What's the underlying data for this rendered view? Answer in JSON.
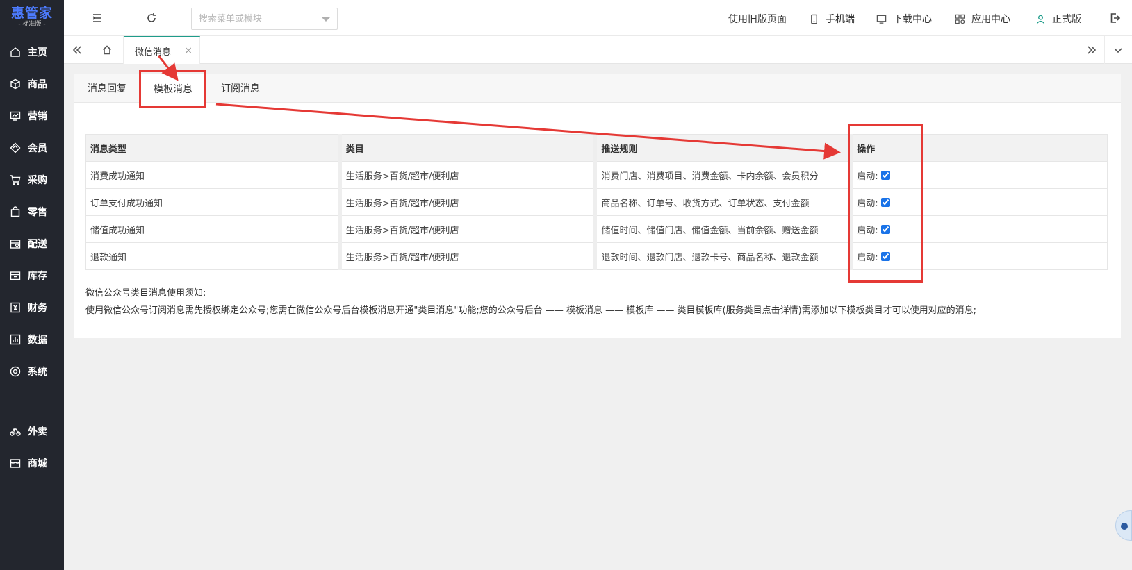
{
  "brand": {
    "name": "惠管家",
    "edition": "- 标准版 -"
  },
  "sidebar": {
    "items": [
      {
        "label": "主页",
        "icon": "home-icon"
      },
      {
        "label": "商品",
        "icon": "box-icon"
      },
      {
        "label": "营销",
        "icon": "chart-screen-icon"
      },
      {
        "label": "会员",
        "icon": "diamond-icon"
      },
      {
        "label": "采购",
        "icon": "cart-icon"
      },
      {
        "label": "零售",
        "icon": "bag-icon"
      },
      {
        "label": "配送",
        "icon": "delivery-icon"
      },
      {
        "label": "库存",
        "icon": "inventory-icon"
      },
      {
        "label": "财务",
        "icon": "yen-icon"
      },
      {
        "label": "数据",
        "icon": "bar-chart-icon"
      },
      {
        "label": "系统",
        "icon": "settings-icon"
      },
      {
        "label": "外卖",
        "icon": "bike-icon"
      },
      {
        "label": "商城",
        "icon": "store-icon"
      }
    ]
  },
  "topbar": {
    "search_placeholder": "搜索菜单或模块",
    "old_version": "使用旧版页面",
    "mobile": "手机端",
    "download": "下载中心",
    "apps": "应用中心",
    "account": "正式版"
  },
  "tabs": {
    "active": "微信消息",
    "close": "×"
  },
  "subtabs": [
    "消息回复",
    "模板消息",
    "订阅消息"
  ],
  "table": {
    "headers": [
      "消息类型",
      "类目",
      "推送规则",
      "操作"
    ],
    "rows": [
      {
        "type": "消费成功通知",
        "category": "生活服务>百货/超市/便利店",
        "rule": "消费门店、消费项目、消费金额、卡内余额、会员积分",
        "op_label": "启动:"
      },
      {
        "type": "订单支付成功通知",
        "category": "生活服务>百货/超市/便利店",
        "rule": "商品名称、订单号、收货方式、订单状态、支付金额",
        "op_label": "启动:"
      },
      {
        "type": "储值成功通知",
        "category": "生活服务>百货/超市/便利店",
        "rule": "储值时间、储值门店、储值金额、当前余额、赠送金额",
        "op_label": "启动:"
      },
      {
        "type": "退款通知",
        "category": "生活服务>百货/超市/便利店",
        "rule": "退款时间、退款门店、退款卡号、商品名称、退款金额",
        "op_label": "启动:"
      }
    ]
  },
  "notice": {
    "title": "微信公众号类目消息使用须知:",
    "body": "使用微信公众号订阅消息需先授权绑定公众号;您需在微信公众号后台模板消息开通\"类目消息\"功能;您的公众号后台 —— 模板消息 —— 模板库 —— 类目模板库(服务类目点击详情)需添加以下模板类目才可以使用对应的消息;"
  },
  "colors": {
    "sidebar_bg": "#23262e",
    "brand_blue": "#4d7cff",
    "tab_accent": "#1e9c8a",
    "annotation_red": "#e53935"
  }
}
